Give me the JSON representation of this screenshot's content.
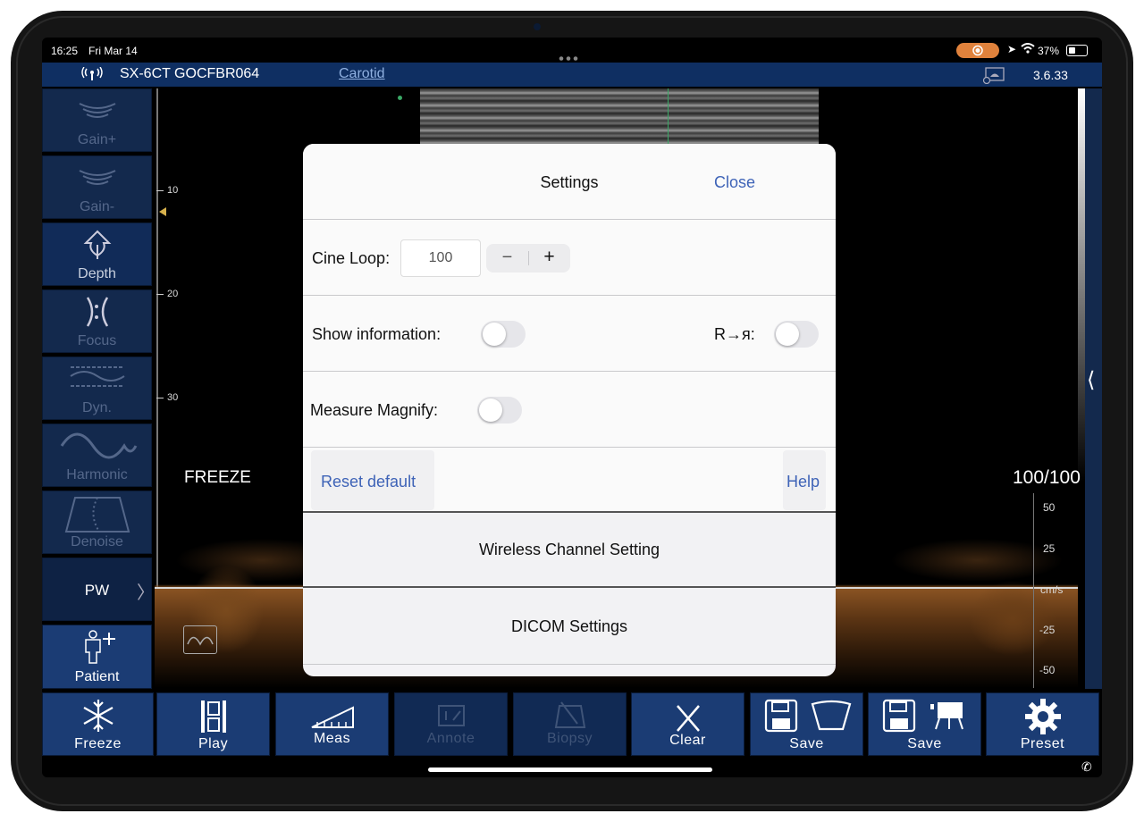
{
  "status": {
    "time": "16:25",
    "date": "Fri Mar 14",
    "battery": "37%"
  },
  "topbar": {
    "device": "SX-6CT GOCFBR064",
    "preset": "Carotid",
    "version": "3.6.33"
  },
  "side_buttons": [
    {
      "label": "Gain+",
      "icon": "gain-plus-icon"
    },
    {
      "label": "Gain-",
      "icon": "gain-minus-icon"
    },
    {
      "label": "Depth",
      "icon": "depth-icon"
    },
    {
      "label": "Focus",
      "icon": "focus-icon"
    },
    {
      "label": "Dyn.",
      "icon": "dynamic-range-icon"
    },
    {
      "label": "Harmonic",
      "icon": "harmonic-icon"
    },
    {
      "label": "Denoise",
      "icon": "denoise-icon"
    },
    {
      "label": "PW",
      "icon": "pw-mode"
    },
    {
      "label": "Patient",
      "icon": "patient-icon"
    }
  ],
  "bottom_buttons": [
    {
      "label": "Freeze",
      "icon": "snowflake-icon"
    },
    {
      "label": "Play",
      "icon": "play-cine-icon"
    },
    {
      "label": "Meas",
      "icon": "measure-icon"
    },
    {
      "label": "Annote",
      "icon": "annotate-icon"
    },
    {
      "label": "Biopsy",
      "icon": "biopsy-icon"
    },
    {
      "label": "Clear",
      "icon": "clear-x-icon"
    },
    {
      "label": "Save",
      "icon": "save-image-icon"
    },
    {
      "label": "Save",
      "icon": "save-video-icon"
    },
    {
      "label": "Preset",
      "icon": "gear-icon"
    }
  ],
  "image": {
    "freeze_label": "FREEZE",
    "frame_counter": "100/100",
    "depth_ticks": [
      "10",
      "20",
      "30"
    ],
    "velocity_ticks": [
      "50",
      "25",
      "cm/s",
      "-25",
      "-50"
    ]
  },
  "settings": {
    "title": "Settings",
    "close": "Close",
    "cine_loop_label": "Cine Loop:",
    "cine_loop_value": "100",
    "stepper_minus": "−",
    "stepper_plus": "+",
    "show_information_label": "Show information:",
    "show_information_on": false,
    "r_flip_label": "R→я:",
    "r_flip_on": false,
    "measure_magnify_label": "Measure Magnify:",
    "measure_magnify_on": false,
    "reset_default": "Reset default",
    "help": "Help",
    "wireless_channel": "Wireless Channel Setting",
    "dicom_settings": "DICOM Settings"
  },
  "colors": {
    "accent": "#3e63b7",
    "bar": "#0f2f62",
    "button": "#1b3c74",
    "recording": "#e0823c"
  }
}
